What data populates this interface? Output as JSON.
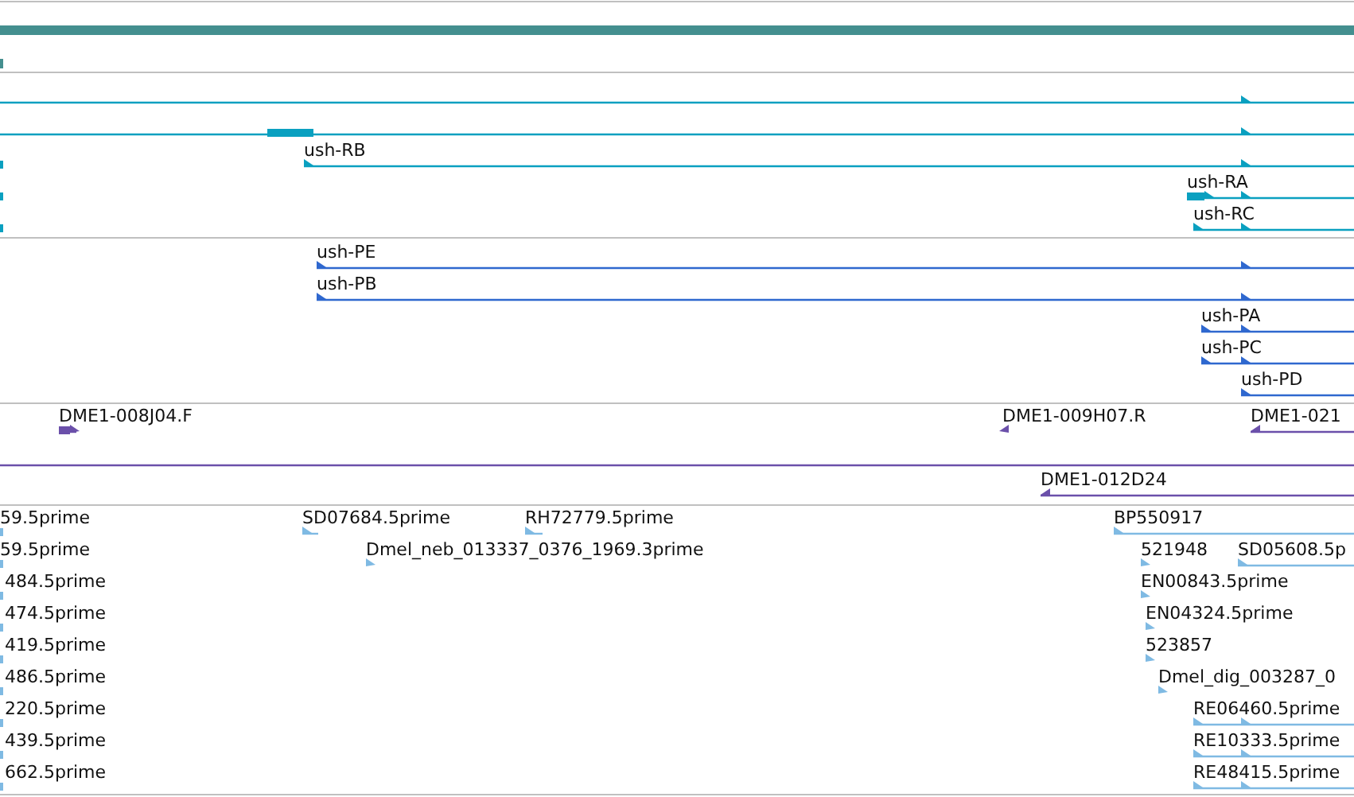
{
  "tracks": [
    {
      "color": "#0aa0c0",
      "features": [
        {
          "reverse": false
        },
        {
          "reverse": false
        },
        {
          "label": "ush-RB",
          "reverse": false
        },
        {
          "label": "ush-RA",
          "reverse": false
        },
        {
          "label": "ush-RC",
          "reverse": false
        }
      ]
    },
    {
      "color": "#2f68cf",
      "features": [
        {
          "label": "ush-PE",
          "reverse": false
        },
        {
          "label": "ush-PB",
          "reverse": false
        },
        {
          "label": "ush-PA",
          "reverse": false
        },
        {
          "label": "ush-PC",
          "reverse": false
        },
        {
          "label": "ush-PD",
          "reverse": false
        }
      ]
    },
    {
      "color": "#6b50aa",
      "features": [
        {
          "label": "DME1-008J04.F",
          "reverse": false
        },
        {
          "label": "DME1-009H07.R",
          "reverse": true
        },
        {
          "label": "DME1-021",
          "reverse": true
        },
        {
          "label": "DME1-012D24",
          "reverse": true
        }
      ]
    },
    {
      "color": "#7fbae3",
      "features": [
        {
          "label": "59.5prime"
        },
        {
          "label": "SD07684.5prime",
          "reverse": false
        },
        {
          "label": "RH72779.5prime",
          "reverse": false
        },
        {
          "label": "BP550917",
          "reverse": false
        },
        {
          "label": "59.5prime"
        },
        {
          "label": "Dmel_neb_013337_0376_1969.3prime",
          "reverse": false
        },
        {
          "label": "521948",
          "reverse": false
        },
        {
          "label": "SD05608.5p",
          "reverse": false
        },
        {
          "label": "484.5prime"
        },
        {
          "label": "EN00843.5prime",
          "reverse": false
        },
        {
          "label": "474.5prime"
        },
        {
          "label": "EN04324.5prime",
          "reverse": false
        },
        {
          "label": "419.5prime"
        },
        {
          "label": "523857",
          "reverse": false
        },
        {
          "label": "486.5prime"
        },
        {
          "label": "Dmel_dig_003287_0",
          "reverse": false
        },
        {
          "label": "220.5prime"
        },
        {
          "label": "RE06460.5prime",
          "reverse": false
        },
        {
          "label": "439.5prime"
        },
        {
          "label": "RE10333.5prime",
          "reverse": false
        },
        {
          "label": "662.5prime"
        },
        {
          "label": "RE48415.5prime",
          "reverse": false
        }
      ]
    }
  ]
}
